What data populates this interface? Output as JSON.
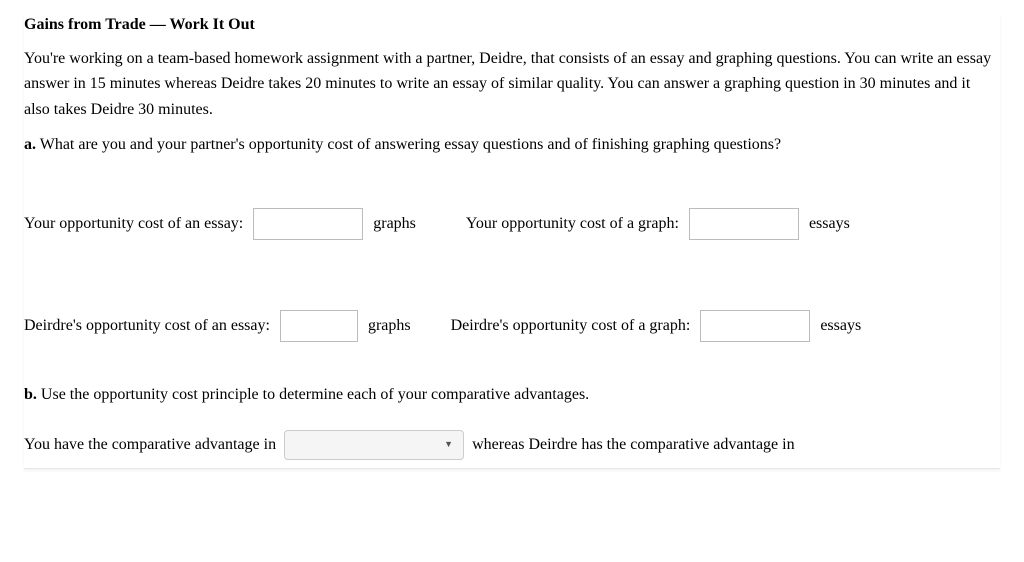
{
  "title": "Gains from Trade — Work It Out",
  "intro": "You're working on a team-based homework assignment with a partner, Deidre, that consists of an essay and graphing questions. You can write an essay answer in 15 minutes whereas Deidre takes 20 minutes to write an essay of similar quality. You can answer a graphing question in 30 minutes and it also takes Deidre 30 minutes.",
  "qa": {
    "label": "a.",
    "text": "What are you and your partner's opportunity cost of answering essay questions and of finishing graphing questions?"
  },
  "row1": {
    "yourEssayLabel": "Your opportunity cost of an essay:",
    "yourEssayUnit": "graphs",
    "yourGraphLabel": "Your opportunity cost of a graph:",
    "yourGraphUnit": "essays"
  },
  "row2": {
    "deirdreEssayLabel": "Deirdre's opportunity cost of an essay:",
    "deirdreEssayUnit": "graphs",
    "deirdreGraphLabel": "Deirdre's opportunity cost of a graph:",
    "deirdreGraphUnit": "essays"
  },
  "qb": {
    "label": "b.",
    "text": "Use the opportunity cost principle to determine each of your comparative advantages."
  },
  "comp": {
    "pre": "You have the comparative advantage in",
    "post": "whereas Deirdre has the comparative advantage in"
  }
}
